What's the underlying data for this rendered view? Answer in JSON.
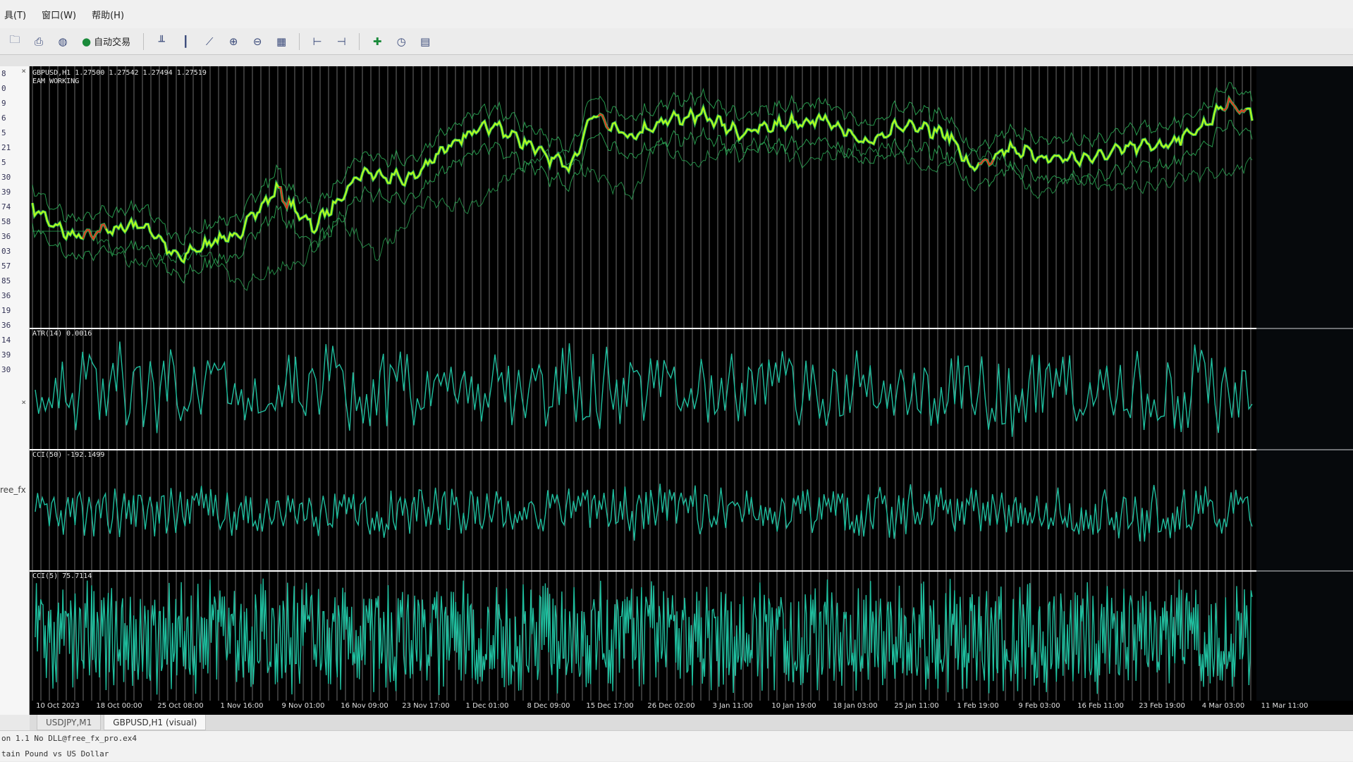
{
  "menu": {
    "items": [
      "具(T)",
      "窗口(W)",
      "帮助(H)"
    ]
  },
  "toolbar": {
    "autotrade_label": "自动交易",
    "icons": [
      "folder-icon",
      "print-icon",
      "globe-icon",
      "autotrade-icon",
      "bar-chart-icon",
      "candle-chart-icon",
      "line-chart-icon",
      "zoom-in-icon",
      "zoom-out-icon",
      "tile-windows-icon",
      "chart-shift-icon",
      "autoscroll-icon",
      "indicators-icon",
      "periods-icon",
      "templates-icon"
    ]
  },
  "left_panel": {
    "values": [
      "8",
      "0",
      "9",
      "6",
      "5",
      "21",
      "5",
      "30",
      "39",
      "74",
      "58",
      "36",
      "03",
      "57",
      "85",
      "36",
      "19",
      "36",
      "14",
      "39",
      "30"
    ],
    "side_label": "ree_fx"
  },
  "chart": {
    "symbol_header": "GBPUSD,H1 1.27500 1.27542 1.27494 1.27519",
    "ea_status": "EAM WORKING",
    "panes": [
      {
        "label": "ATR(14) 0.0016"
      },
      {
        "label": "CCI(50) -192.1499"
      },
      {
        "label": "CCI(5) 75.7114"
      }
    ],
    "x_ticks": [
      "10 Oct 2023",
      "18 Oct 00:00",
      "25 Oct 08:00",
      "1 Nov 16:00",
      "9 Nov 01:00",
      "16 Nov 09:00",
      "23 Nov 17:00",
      "1 Dec 01:00",
      "8 Dec 09:00",
      "15 Dec 17:00",
      "26 Dec 02:00",
      "3 Jan 11:00",
      "10 Jan 19:00",
      "18 Jan 03:00",
      "25 Jan 11:00",
      "1 Feb 19:00",
      "9 Feb 03:00",
      "16 Feb 11:00",
      "23 Feb 19:00",
      "4 Mar 03:00",
      "11 Mar 11:00"
    ],
    "colors": {
      "background": "#000000",
      "grid": "#c8c8c8",
      "price": "#b8ff1a",
      "bands": "#2fbf5f",
      "down": "#e03020",
      "oscillator": "#1fbf9f",
      "separator": "#ffffff"
    }
  },
  "tabs": [
    {
      "label": "USDJPY,M1",
      "active": false
    },
    {
      "label": "GBPUSD,H1 (visual)",
      "active": true
    }
  ],
  "status": {
    "line1": "on 1.1 No DLL@free_fx_pro.ex4",
    "line2": "tain Pound vs US Dollar"
  }
}
